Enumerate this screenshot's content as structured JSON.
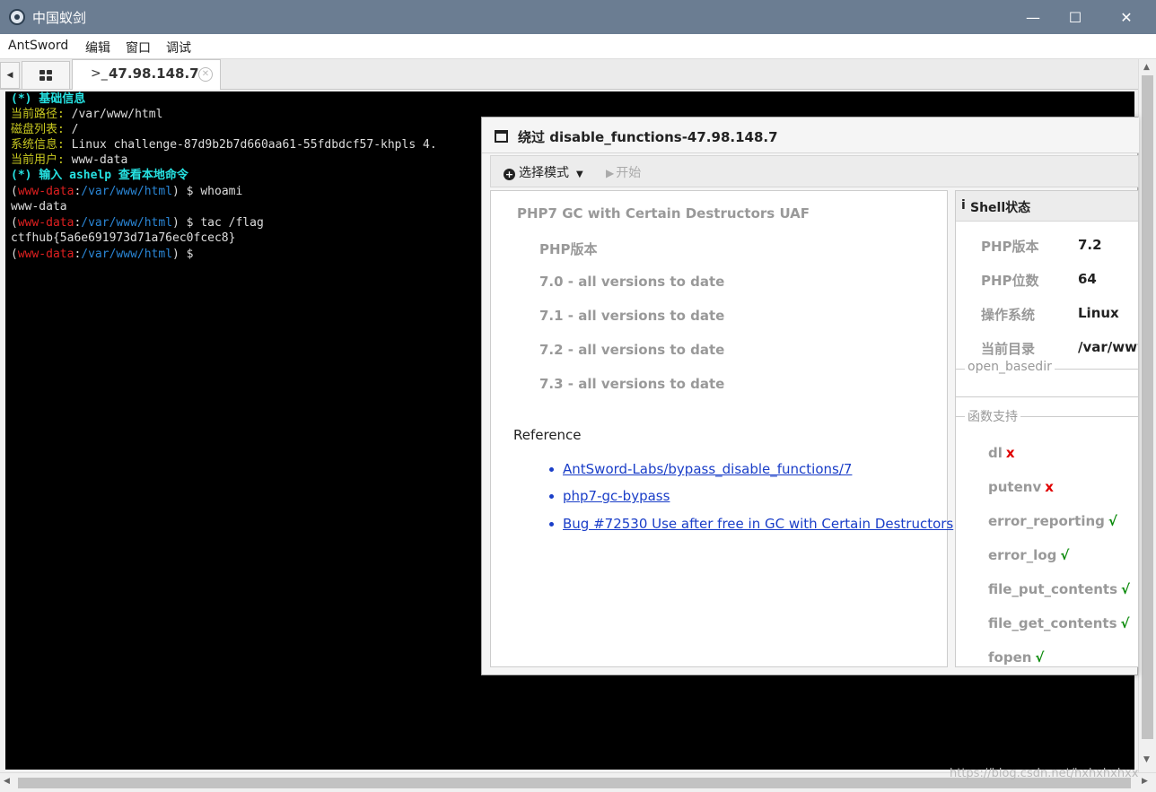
{
  "window": {
    "title": "中国蚁剑",
    "minimize": "—",
    "maximize": "☐",
    "close": "✕"
  },
  "menu": [
    "AntSword",
    "编辑",
    "窗口",
    "调试"
  ],
  "tabs": {
    "prompt_glyph": ">_",
    "active_label": "47.98.148.7",
    "close_glyph": "✕"
  },
  "terminal": {
    "header": "(*) 基础信息",
    "path_label": "当前路径:",
    "path_value": " /var/www/html",
    "disk_label": "磁盘列表:",
    "disk_value": " /",
    "sys_label": "系统信息:",
    "sys_value": " Linux challenge-87d9b2b7d660aa61-55fdbdcf57-khpls 4.",
    "user_label": "当前用户:",
    "user_value": " www-data",
    "help_line": "(*) 输入 ashelp 查看本地命令",
    "prompt_user": "www-data",
    "prompt_sep": ":",
    "prompt_path": "/var/www/html",
    "cmd1": ") $ whoami",
    "out1": "www-data",
    "cmd2": ") $ tac /flag",
    "out2": "ctfhub{5a6e691973d71a76ec0fcec8}",
    "cmd3": ") $",
    "paren_open": "("
  },
  "dialog": {
    "title": "绕过 disable_functions-47.98.148.7",
    "mode_label": "选择模式",
    "start_label": "开始",
    "exploit_name": "PHP7 GC with Certain Destructors UAF",
    "php_version_heading": "PHP版本",
    "versions": [
      "7.0 - all versions to date",
      "7.1 - all versions to date",
      "7.2 - all versions to date",
      "7.3 - all versions to date"
    ],
    "reference_label": "Reference",
    "links": [
      "AntSword-Labs/bypass_disable_functions/7",
      "php7-gc-bypass",
      "Bug #72530 Use after free in GC with Certain Destructors"
    ],
    "status": {
      "title": "Shell状态",
      "rows": [
        {
          "label": "PHP版本",
          "value": "7.2"
        },
        {
          "label": "PHP位数",
          "value": "64"
        },
        {
          "label": "操作系统",
          "value": "Linux"
        },
        {
          "label": "当前目录",
          "value": "/var/www"
        }
      ],
      "open_basedir_legend": "open_basedir",
      "functions_legend": "函数支持",
      "functions": [
        {
          "name": "dl",
          "mark": "x",
          "supported": false
        },
        {
          "name": "putenv",
          "mark": "x",
          "supported": false
        },
        {
          "name": "error_reporting",
          "mark": "√",
          "supported": true
        },
        {
          "name": "error_log",
          "mark": "√",
          "supported": true
        },
        {
          "name": "file_put_contents",
          "mark": "√",
          "supported": true
        },
        {
          "name": "file_get_contents",
          "mark": "√",
          "supported": true
        },
        {
          "name": "fopen",
          "mark": "√",
          "supported": true
        }
      ]
    }
  },
  "watermark": "https://blog.csdn.net/hxhxhxhxx"
}
